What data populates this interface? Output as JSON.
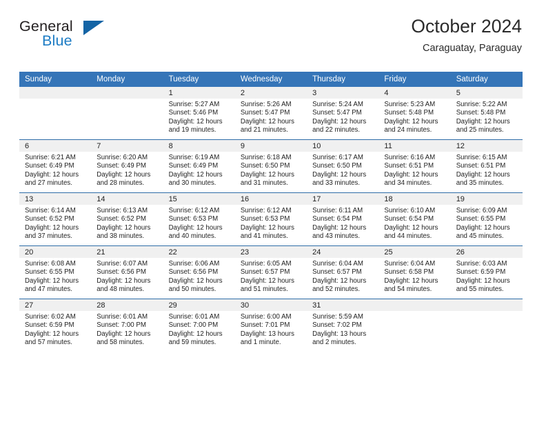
{
  "brand": {
    "name_top": "General",
    "name_bottom": "Blue",
    "triangle_icon": "triangle-icon",
    "accent_color": "#1d7cc4",
    "triangle_color": "#1464a5"
  },
  "header": {
    "title": "October 2024",
    "subtitle": "Caraguatay, Paraguay"
  },
  "theme": {
    "header_row_bg": "#3575b8",
    "header_row_text": "#ffffff",
    "daynum_band_bg": "#f0f0f0",
    "row_divider": "#2e6da8"
  },
  "weekday_headers": [
    "Sunday",
    "Monday",
    "Tuesday",
    "Wednesday",
    "Thursday",
    "Friday",
    "Saturday"
  ],
  "weeks": [
    [
      {
        "day": "",
        "sunrise": "",
        "sunset": "",
        "daylight_line1": "",
        "daylight_line2": ""
      },
      {
        "day": "",
        "sunrise": "",
        "sunset": "",
        "daylight_line1": "",
        "daylight_line2": ""
      },
      {
        "day": "1",
        "sunrise": "Sunrise: 5:27 AM",
        "sunset": "Sunset: 5:46 PM",
        "daylight_line1": "Daylight: 12 hours",
        "daylight_line2": "and 19 minutes."
      },
      {
        "day": "2",
        "sunrise": "Sunrise: 5:26 AM",
        "sunset": "Sunset: 5:47 PM",
        "daylight_line1": "Daylight: 12 hours",
        "daylight_line2": "and 21 minutes."
      },
      {
        "day": "3",
        "sunrise": "Sunrise: 5:24 AM",
        "sunset": "Sunset: 5:47 PM",
        "daylight_line1": "Daylight: 12 hours",
        "daylight_line2": "and 22 minutes."
      },
      {
        "day": "4",
        "sunrise": "Sunrise: 5:23 AM",
        "sunset": "Sunset: 5:48 PM",
        "daylight_line1": "Daylight: 12 hours",
        "daylight_line2": "and 24 minutes."
      },
      {
        "day": "5",
        "sunrise": "Sunrise: 5:22 AM",
        "sunset": "Sunset: 5:48 PM",
        "daylight_line1": "Daylight: 12 hours",
        "daylight_line2": "and 25 minutes."
      }
    ],
    [
      {
        "day": "6",
        "sunrise": "Sunrise: 6:21 AM",
        "sunset": "Sunset: 6:49 PM",
        "daylight_line1": "Daylight: 12 hours",
        "daylight_line2": "and 27 minutes."
      },
      {
        "day": "7",
        "sunrise": "Sunrise: 6:20 AM",
        "sunset": "Sunset: 6:49 PM",
        "daylight_line1": "Daylight: 12 hours",
        "daylight_line2": "and 28 minutes."
      },
      {
        "day": "8",
        "sunrise": "Sunrise: 6:19 AM",
        "sunset": "Sunset: 6:49 PM",
        "daylight_line1": "Daylight: 12 hours",
        "daylight_line2": "and 30 minutes."
      },
      {
        "day": "9",
        "sunrise": "Sunrise: 6:18 AM",
        "sunset": "Sunset: 6:50 PM",
        "daylight_line1": "Daylight: 12 hours",
        "daylight_line2": "and 31 minutes."
      },
      {
        "day": "10",
        "sunrise": "Sunrise: 6:17 AM",
        "sunset": "Sunset: 6:50 PM",
        "daylight_line1": "Daylight: 12 hours",
        "daylight_line2": "and 33 minutes."
      },
      {
        "day": "11",
        "sunrise": "Sunrise: 6:16 AM",
        "sunset": "Sunset: 6:51 PM",
        "daylight_line1": "Daylight: 12 hours",
        "daylight_line2": "and 34 minutes."
      },
      {
        "day": "12",
        "sunrise": "Sunrise: 6:15 AM",
        "sunset": "Sunset: 6:51 PM",
        "daylight_line1": "Daylight: 12 hours",
        "daylight_line2": "and 35 minutes."
      }
    ],
    [
      {
        "day": "13",
        "sunrise": "Sunrise: 6:14 AM",
        "sunset": "Sunset: 6:52 PM",
        "daylight_line1": "Daylight: 12 hours",
        "daylight_line2": "and 37 minutes."
      },
      {
        "day": "14",
        "sunrise": "Sunrise: 6:13 AM",
        "sunset": "Sunset: 6:52 PM",
        "daylight_line1": "Daylight: 12 hours",
        "daylight_line2": "and 38 minutes."
      },
      {
        "day": "15",
        "sunrise": "Sunrise: 6:12 AM",
        "sunset": "Sunset: 6:53 PM",
        "daylight_line1": "Daylight: 12 hours",
        "daylight_line2": "and 40 minutes."
      },
      {
        "day": "16",
        "sunrise": "Sunrise: 6:12 AM",
        "sunset": "Sunset: 6:53 PM",
        "daylight_line1": "Daylight: 12 hours",
        "daylight_line2": "and 41 minutes."
      },
      {
        "day": "17",
        "sunrise": "Sunrise: 6:11 AM",
        "sunset": "Sunset: 6:54 PM",
        "daylight_line1": "Daylight: 12 hours",
        "daylight_line2": "and 43 minutes."
      },
      {
        "day": "18",
        "sunrise": "Sunrise: 6:10 AM",
        "sunset": "Sunset: 6:54 PM",
        "daylight_line1": "Daylight: 12 hours",
        "daylight_line2": "and 44 minutes."
      },
      {
        "day": "19",
        "sunrise": "Sunrise: 6:09 AM",
        "sunset": "Sunset: 6:55 PM",
        "daylight_line1": "Daylight: 12 hours",
        "daylight_line2": "and 45 minutes."
      }
    ],
    [
      {
        "day": "20",
        "sunrise": "Sunrise: 6:08 AM",
        "sunset": "Sunset: 6:55 PM",
        "daylight_line1": "Daylight: 12 hours",
        "daylight_line2": "and 47 minutes."
      },
      {
        "day": "21",
        "sunrise": "Sunrise: 6:07 AM",
        "sunset": "Sunset: 6:56 PM",
        "daylight_line1": "Daylight: 12 hours",
        "daylight_line2": "and 48 minutes."
      },
      {
        "day": "22",
        "sunrise": "Sunrise: 6:06 AM",
        "sunset": "Sunset: 6:56 PM",
        "daylight_line1": "Daylight: 12 hours",
        "daylight_line2": "and 50 minutes."
      },
      {
        "day": "23",
        "sunrise": "Sunrise: 6:05 AM",
        "sunset": "Sunset: 6:57 PM",
        "daylight_line1": "Daylight: 12 hours",
        "daylight_line2": "and 51 minutes."
      },
      {
        "day": "24",
        "sunrise": "Sunrise: 6:04 AM",
        "sunset": "Sunset: 6:57 PM",
        "daylight_line1": "Daylight: 12 hours",
        "daylight_line2": "and 52 minutes."
      },
      {
        "day": "25",
        "sunrise": "Sunrise: 6:04 AM",
        "sunset": "Sunset: 6:58 PM",
        "daylight_line1": "Daylight: 12 hours",
        "daylight_line2": "and 54 minutes."
      },
      {
        "day": "26",
        "sunrise": "Sunrise: 6:03 AM",
        "sunset": "Sunset: 6:59 PM",
        "daylight_line1": "Daylight: 12 hours",
        "daylight_line2": "and 55 minutes."
      }
    ],
    [
      {
        "day": "27",
        "sunrise": "Sunrise: 6:02 AM",
        "sunset": "Sunset: 6:59 PM",
        "daylight_line1": "Daylight: 12 hours",
        "daylight_line2": "and 57 minutes."
      },
      {
        "day": "28",
        "sunrise": "Sunrise: 6:01 AM",
        "sunset": "Sunset: 7:00 PM",
        "daylight_line1": "Daylight: 12 hours",
        "daylight_line2": "and 58 minutes."
      },
      {
        "day": "29",
        "sunrise": "Sunrise: 6:01 AM",
        "sunset": "Sunset: 7:00 PM",
        "daylight_line1": "Daylight: 12 hours",
        "daylight_line2": "and 59 minutes."
      },
      {
        "day": "30",
        "sunrise": "Sunrise: 6:00 AM",
        "sunset": "Sunset: 7:01 PM",
        "daylight_line1": "Daylight: 13 hours",
        "daylight_line2": "and 1 minute."
      },
      {
        "day": "31",
        "sunrise": "Sunrise: 5:59 AM",
        "sunset": "Sunset: 7:02 PM",
        "daylight_line1": "Daylight: 13 hours",
        "daylight_line2": "and 2 minutes."
      },
      {
        "day": "",
        "sunrise": "",
        "sunset": "",
        "daylight_line1": "",
        "daylight_line2": ""
      },
      {
        "day": "",
        "sunrise": "",
        "sunset": "",
        "daylight_line1": "",
        "daylight_line2": ""
      }
    ]
  ]
}
